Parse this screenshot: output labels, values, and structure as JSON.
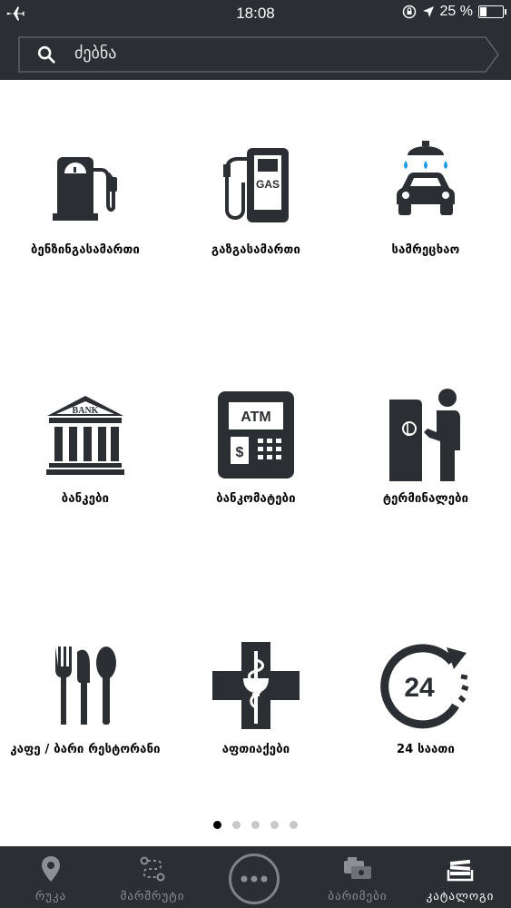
{
  "status_bar": {
    "time": "18:08",
    "battery_percent": "25 %",
    "battery_level": 0.25
  },
  "search": {
    "placeholder": "ძებნა"
  },
  "categories": [
    {
      "label": "ბენზინგასამართი",
      "icon": "fuel-pump-icon"
    },
    {
      "label": "გაზგასამართი",
      "icon": "gas-pump-icon"
    },
    {
      "label": "სამრეცხაო",
      "icon": "car-wash-icon"
    },
    {
      "label": "ბანკები",
      "icon": "bank-icon",
      "icon_text": "BANK"
    },
    {
      "label": "ბანკომატები",
      "icon": "atm-icon",
      "icon_text": "ATM"
    },
    {
      "label": "ტერმინალები",
      "icon": "payment-terminal-icon"
    },
    {
      "label": "კაფე / ბარი რესტორანი",
      "icon": "cutlery-icon"
    },
    {
      "label": "აფთიაქები",
      "icon": "pharmacy-cross-icon"
    },
    {
      "label": "24 საათი",
      "icon": "clock-24-icon",
      "icon_text": "24"
    }
  ],
  "gas_icon_text": "GAS",
  "pagination": {
    "pages": 5,
    "current": 1
  },
  "tabs": [
    {
      "label": "რუკა",
      "icon": "map-pin-icon"
    },
    {
      "label": "მარშრუტი",
      "icon": "route-icon"
    },
    {
      "label": "",
      "icon": "more-icon"
    },
    {
      "label": "ბარიმები",
      "icon": "wallet-icon"
    },
    {
      "label": "კატალოგი",
      "icon": "catalog-stack-icon"
    }
  ],
  "colors": {
    "header_bg": "#2b2e32",
    "icon_dark": "#2b2e32",
    "tab_inactive": "#8c8f93",
    "tab_active": "#ffffff",
    "wash_drops": "#1e9be3"
  }
}
